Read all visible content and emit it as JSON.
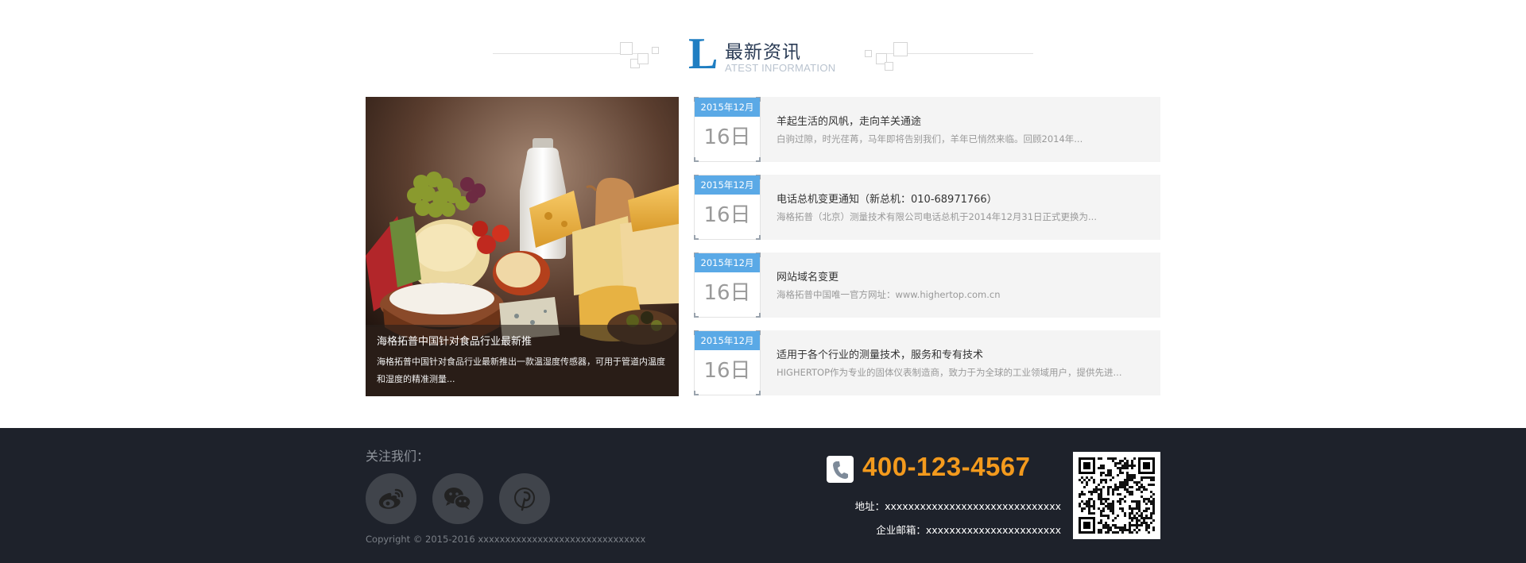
{
  "section": {
    "title_cn": "最新资讯",
    "title_letter": "L",
    "title_en": "ATEST INFORMATION"
  },
  "feature": {
    "title": "海格拓普中国针对食品行业最新推",
    "desc": "海格拓普中国针对食品行业最新推出一款温湿度传感器，可用于管道内温度和湿度的精准测量..."
  },
  "news": [
    {
      "month": "2015年12月",
      "day": "16日",
      "title": "羊起生活的风帆，走向羊关通途",
      "desc": "白驹过隙，时光荏苒，马年即将告别我们，羊年已悄然来临。回顾2014年..."
    },
    {
      "month": "2015年12月",
      "day": "16日",
      "title": "电话总机变更通知（新总机：010-68971766）",
      "desc": "海格拓普（北京）测量技术有限公司电话总机于2014年12月31日正式更换为..."
    },
    {
      "month": "2015年12月",
      "day": "16日",
      "title": "网站域名变更",
      "desc": "海格拓普中国唯一官方网址：www.highertop.com.cn"
    },
    {
      "month": "2015年12月",
      "day": "16日",
      "title": "适用于各个行业的测量技术，服务和专有技术",
      "desc": "HIGHERTOP作为专业的固体仪表制造商，致力于为全球的工业领域用户，提供先进..."
    }
  ],
  "footer": {
    "follow_label": "关注我们：",
    "social": [
      {
        "icon": "weibo-icon"
      },
      {
        "icon": "wechat-icon"
      },
      {
        "icon": "pinterest-icon"
      }
    ],
    "copyright": "Copyright © 2015-2016 xxxxxxxxxxxxxxxxxxxxxxxxxxxxxxx",
    "phone": "400-123-4567",
    "address": "地址：xxxxxxxxxxxxxxxxxxxxxxxxxxxxxx",
    "email": "企业邮箱：xxxxxxxxxxxxxxxxxxxxxxx"
  },
  "colors": {
    "accent_blue": "#5aa9e6",
    "phone_orange": "#f39a1d",
    "footer_bg": "#1e222b"
  }
}
